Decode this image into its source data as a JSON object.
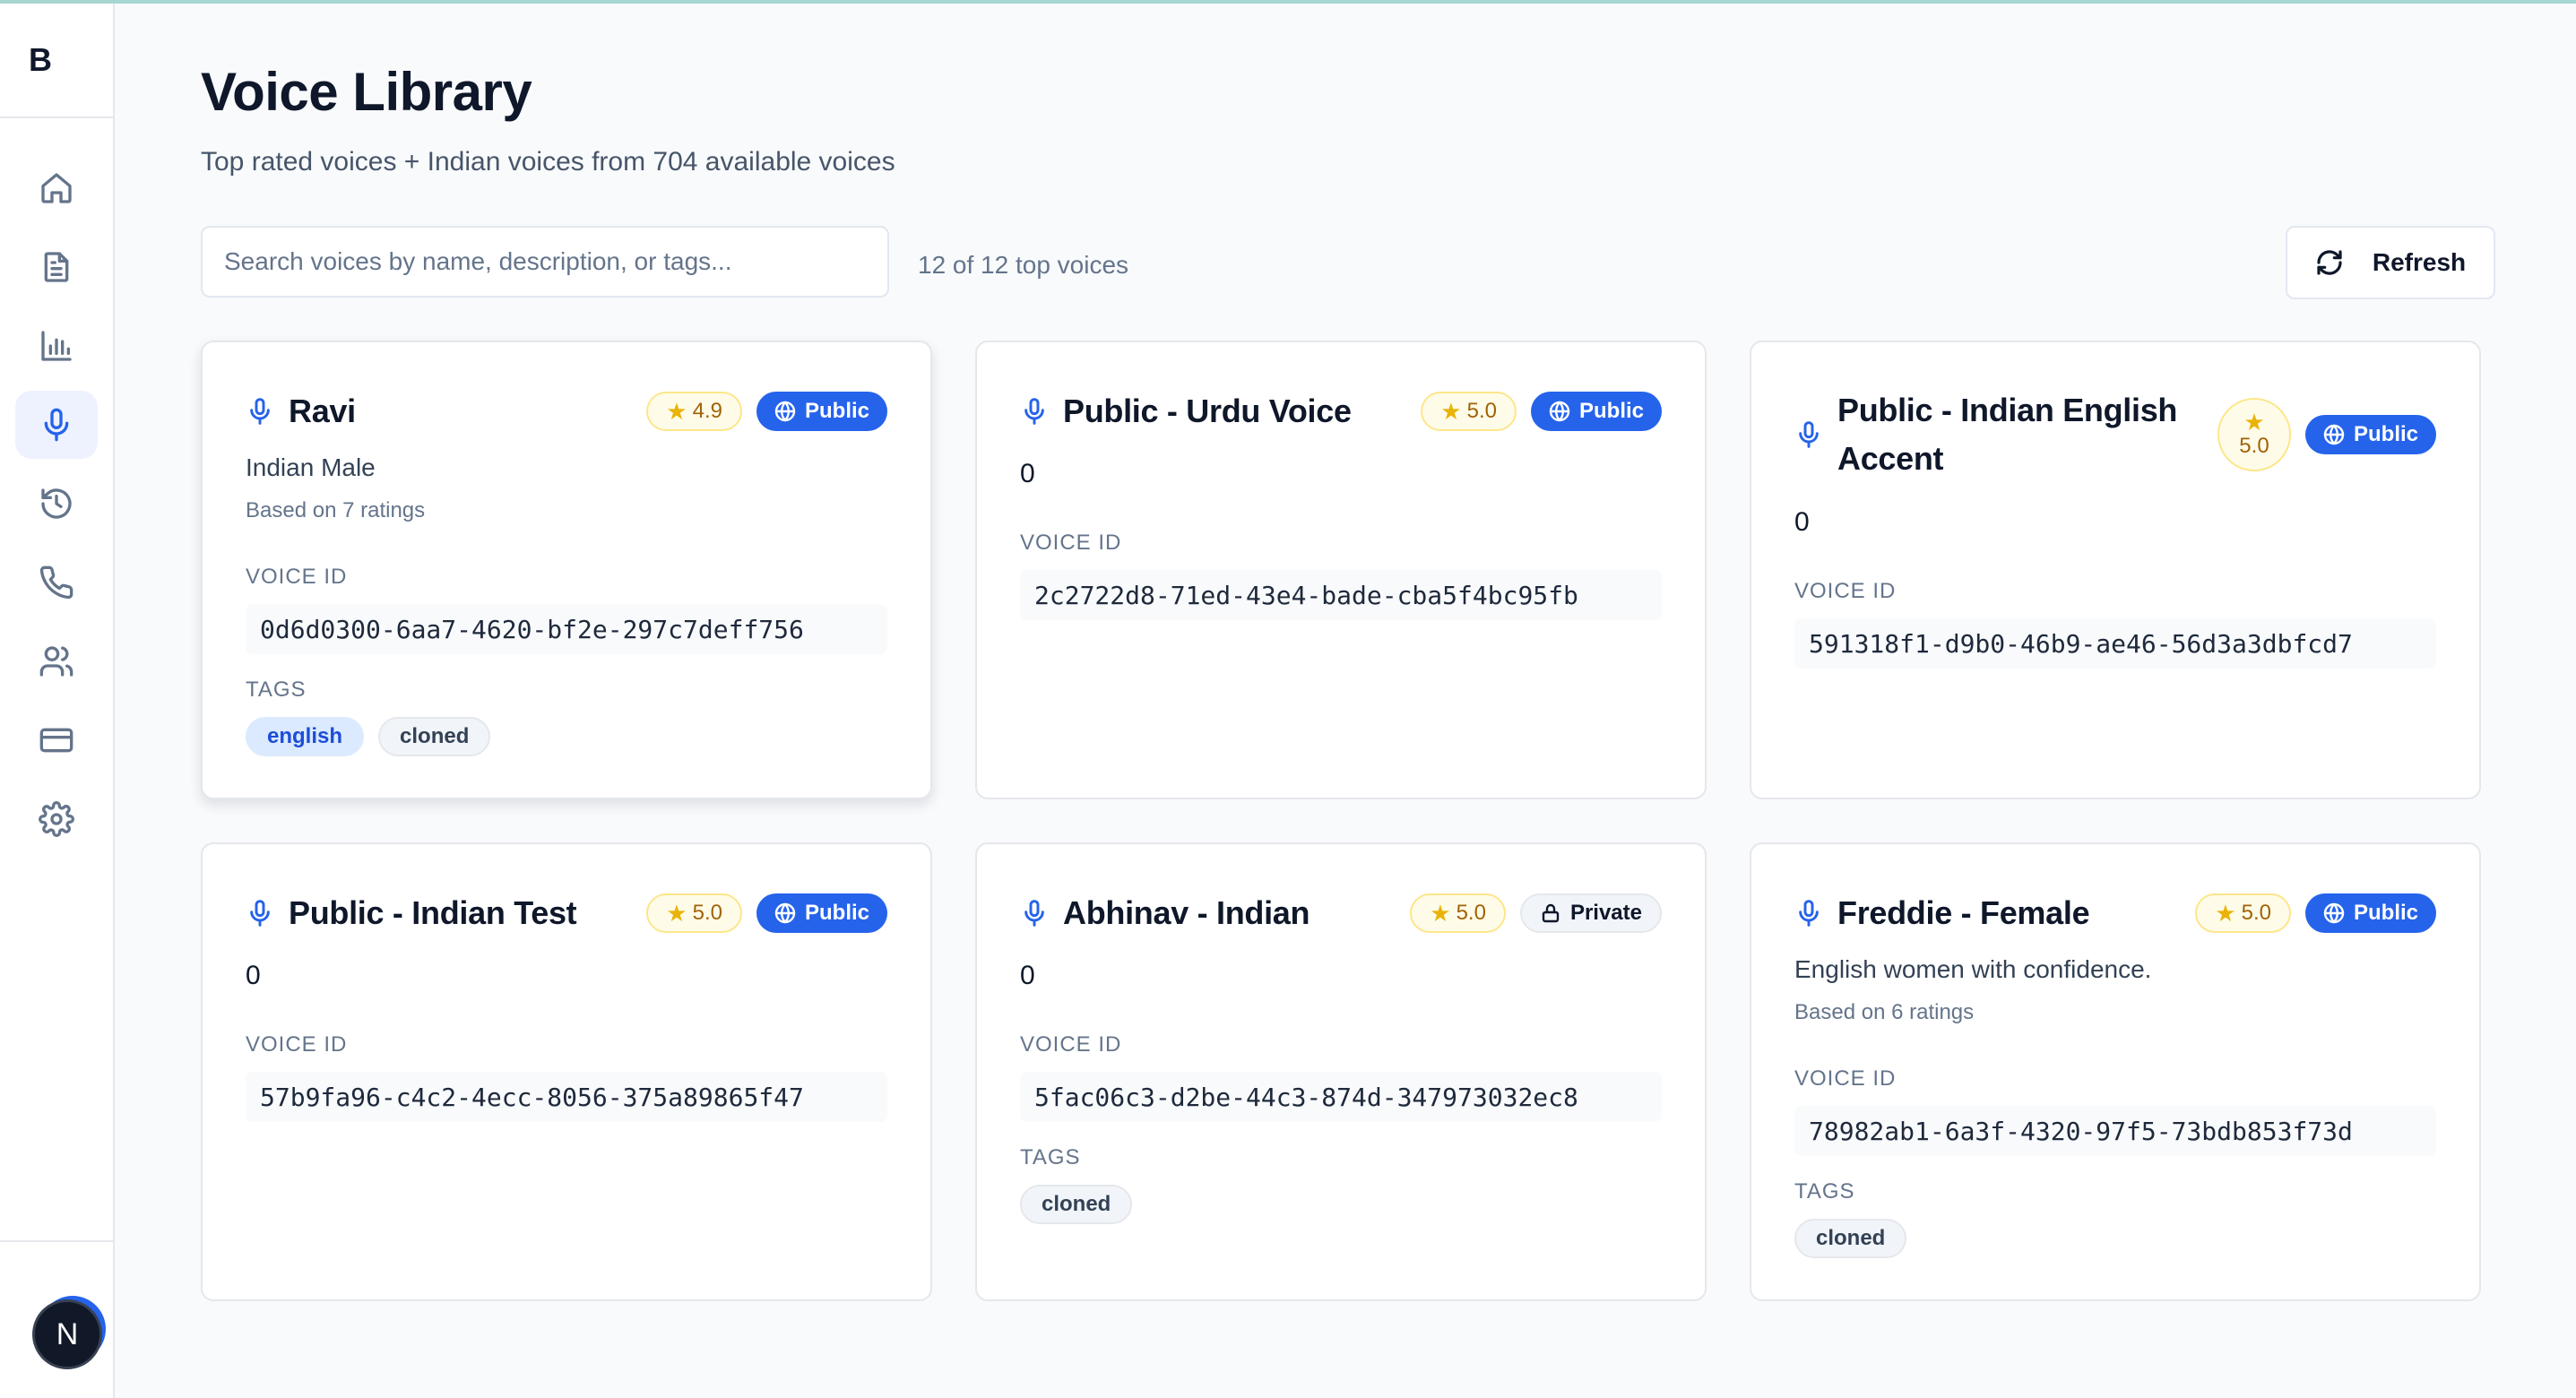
{
  "brand": "B",
  "sidebar": {
    "items": [
      {
        "icon": "home-icon"
      },
      {
        "icon": "document-icon"
      },
      {
        "icon": "bar-chart-icon"
      },
      {
        "icon": "microphone-icon",
        "active": true
      },
      {
        "icon": "history-icon"
      },
      {
        "icon": "phone-icon"
      },
      {
        "icon": "users-icon"
      },
      {
        "icon": "credit-card-icon"
      },
      {
        "icon": "settings-icon"
      }
    ],
    "avatar_initial": "N"
  },
  "header": {
    "title": "Voice Library",
    "subtitle": "Top rated voices + Indian voices from 704 available voices"
  },
  "toolbar": {
    "search_placeholder": "Search voices by name, description, or tags...",
    "count_text": "12 of 12 top voices",
    "refresh_label": "Refresh"
  },
  "labels": {
    "voice_id": "VOICE ID",
    "tags": "TAGS"
  },
  "cards": [
    {
      "name": "Ravi",
      "rating": "4.9",
      "visibility": "Public",
      "description": "Indian Male",
      "ratings_note": "Based on 7 ratings",
      "voice_id": "0d6d0300-6aa7-4620-bf2e-297c7deff756",
      "tags": [
        "english",
        "cloned"
      ]
    },
    {
      "name": "Public - Urdu Voice",
      "rating": "5.0",
      "visibility": "Public",
      "description": "0",
      "voice_id": "2c2722d8-71ed-43e4-bade-cba5f4bc95fb",
      "tags": []
    },
    {
      "name": "Public - Indian English Accent",
      "rating": "5.0",
      "visibility": "Public",
      "description": "0",
      "voice_id": "591318f1-d9b0-46b9-ae46-56d3a3dbfcd7",
      "tags": []
    },
    {
      "name": "Public - Indian Test",
      "rating": "5.0",
      "visibility": "Public",
      "description": "0",
      "voice_id": "57b9fa96-c4c2-4ecc-8056-375a89865f47",
      "tags": []
    },
    {
      "name": "Abhinav - Indian",
      "rating": "5.0",
      "visibility": "Private",
      "description": "0",
      "voice_id": "5fac06c3-d2be-44c3-874d-347973032ec8",
      "tags": [
        "cloned"
      ]
    },
    {
      "name": "Freddie - Female",
      "rating": "5.0",
      "visibility": "Public",
      "description": "English women with confidence.",
      "ratings_note": "Based on 6 ratings",
      "voice_id": "78982ab1-6a3f-4320-97f5-73bdb853f73d",
      "tags": [
        "cloned"
      ]
    }
  ]
}
